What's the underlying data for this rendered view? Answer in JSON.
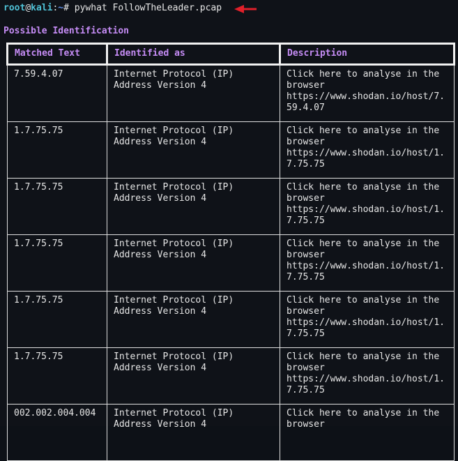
{
  "prompt": {
    "user": "root",
    "at": "@",
    "host": "kali",
    "sep": ":",
    "path": "~",
    "hash": "# ",
    "command": "pywhat FollowTheLeader.pcap"
  },
  "colors": {
    "arrow": "#e0202a",
    "heading": "#c58cf5",
    "prompt": "#4fc1d6"
  },
  "heading": "Possible Identification",
  "table": {
    "headers": [
      "Matched Text",
      "Identified as",
      "Description"
    ],
    "rows": [
      {
        "matched": "7.59.4.07",
        "identified": "Internet Protocol (IP)\nAddress Version 4",
        "description": "Click here to analyse in the browser\nhttps://www.shodan.io/host/7.59.4.07"
      },
      {
        "matched": "1.7.75.75",
        "identified": "Internet Protocol (IP)\nAddress Version 4",
        "description": "Click here to analyse in the browser\nhttps://www.shodan.io/host/1.7.75.75"
      },
      {
        "matched": "1.7.75.75",
        "identified": "Internet Protocol (IP)\nAddress Version 4",
        "description": "Click here to analyse in the browser\nhttps://www.shodan.io/host/1.7.75.75"
      },
      {
        "matched": "1.7.75.75",
        "identified": "Internet Protocol (IP)\nAddress Version 4",
        "description": "Click here to analyse in the browser\nhttps://www.shodan.io/host/1.7.75.75"
      },
      {
        "matched": "1.7.75.75",
        "identified": "Internet Protocol (IP)\nAddress Version 4",
        "description": "Click here to analyse in the browser\nhttps://www.shodan.io/host/1.7.75.75"
      },
      {
        "matched": "1.7.75.75",
        "identified": "Internet Protocol (IP)\nAddress Version 4",
        "description": "Click here to analyse in the browser\nhttps://www.shodan.io/host/1.7.75.75"
      },
      {
        "matched": "002.002.004.004",
        "identified": "Internet Protocol (IP)\nAddress Version 4",
        "description": "Click here to analyse in the browser"
      }
    ]
  }
}
